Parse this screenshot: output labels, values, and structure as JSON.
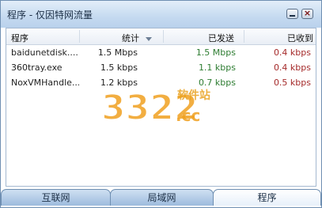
{
  "window": {
    "title": "程序 - 仅因特网流量"
  },
  "table": {
    "headers": {
      "program": "程序",
      "total": "统计",
      "sent": "已发送",
      "received": "已收到"
    },
    "rows": [
      {
        "name": "baidunetdisk....",
        "total": "1.5 Mbps",
        "sent": "1.5 Mbps",
        "received": "0.4 kbps"
      },
      {
        "name": "360tray.exe",
        "total": "1.5 kbps",
        "sent": "1.1 kbps",
        "received": "0.4 kbps"
      },
      {
        "name": "NoxVMHandle....",
        "total": "1.2 kbps",
        "sent": "0.7 kbps",
        "received": "0.5 kbps"
      }
    ]
  },
  "tabs": {
    "internet": "互联网",
    "lan": "局域网",
    "programs": "程序"
  },
  "watermark": {
    "brand": "3322",
    "domain": ".cc",
    "tagline": "软件站"
  },
  "colors": {
    "sent": "#2e7d32",
    "received": "#a52a2a",
    "titlebar": "#c5daf0"
  }
}
